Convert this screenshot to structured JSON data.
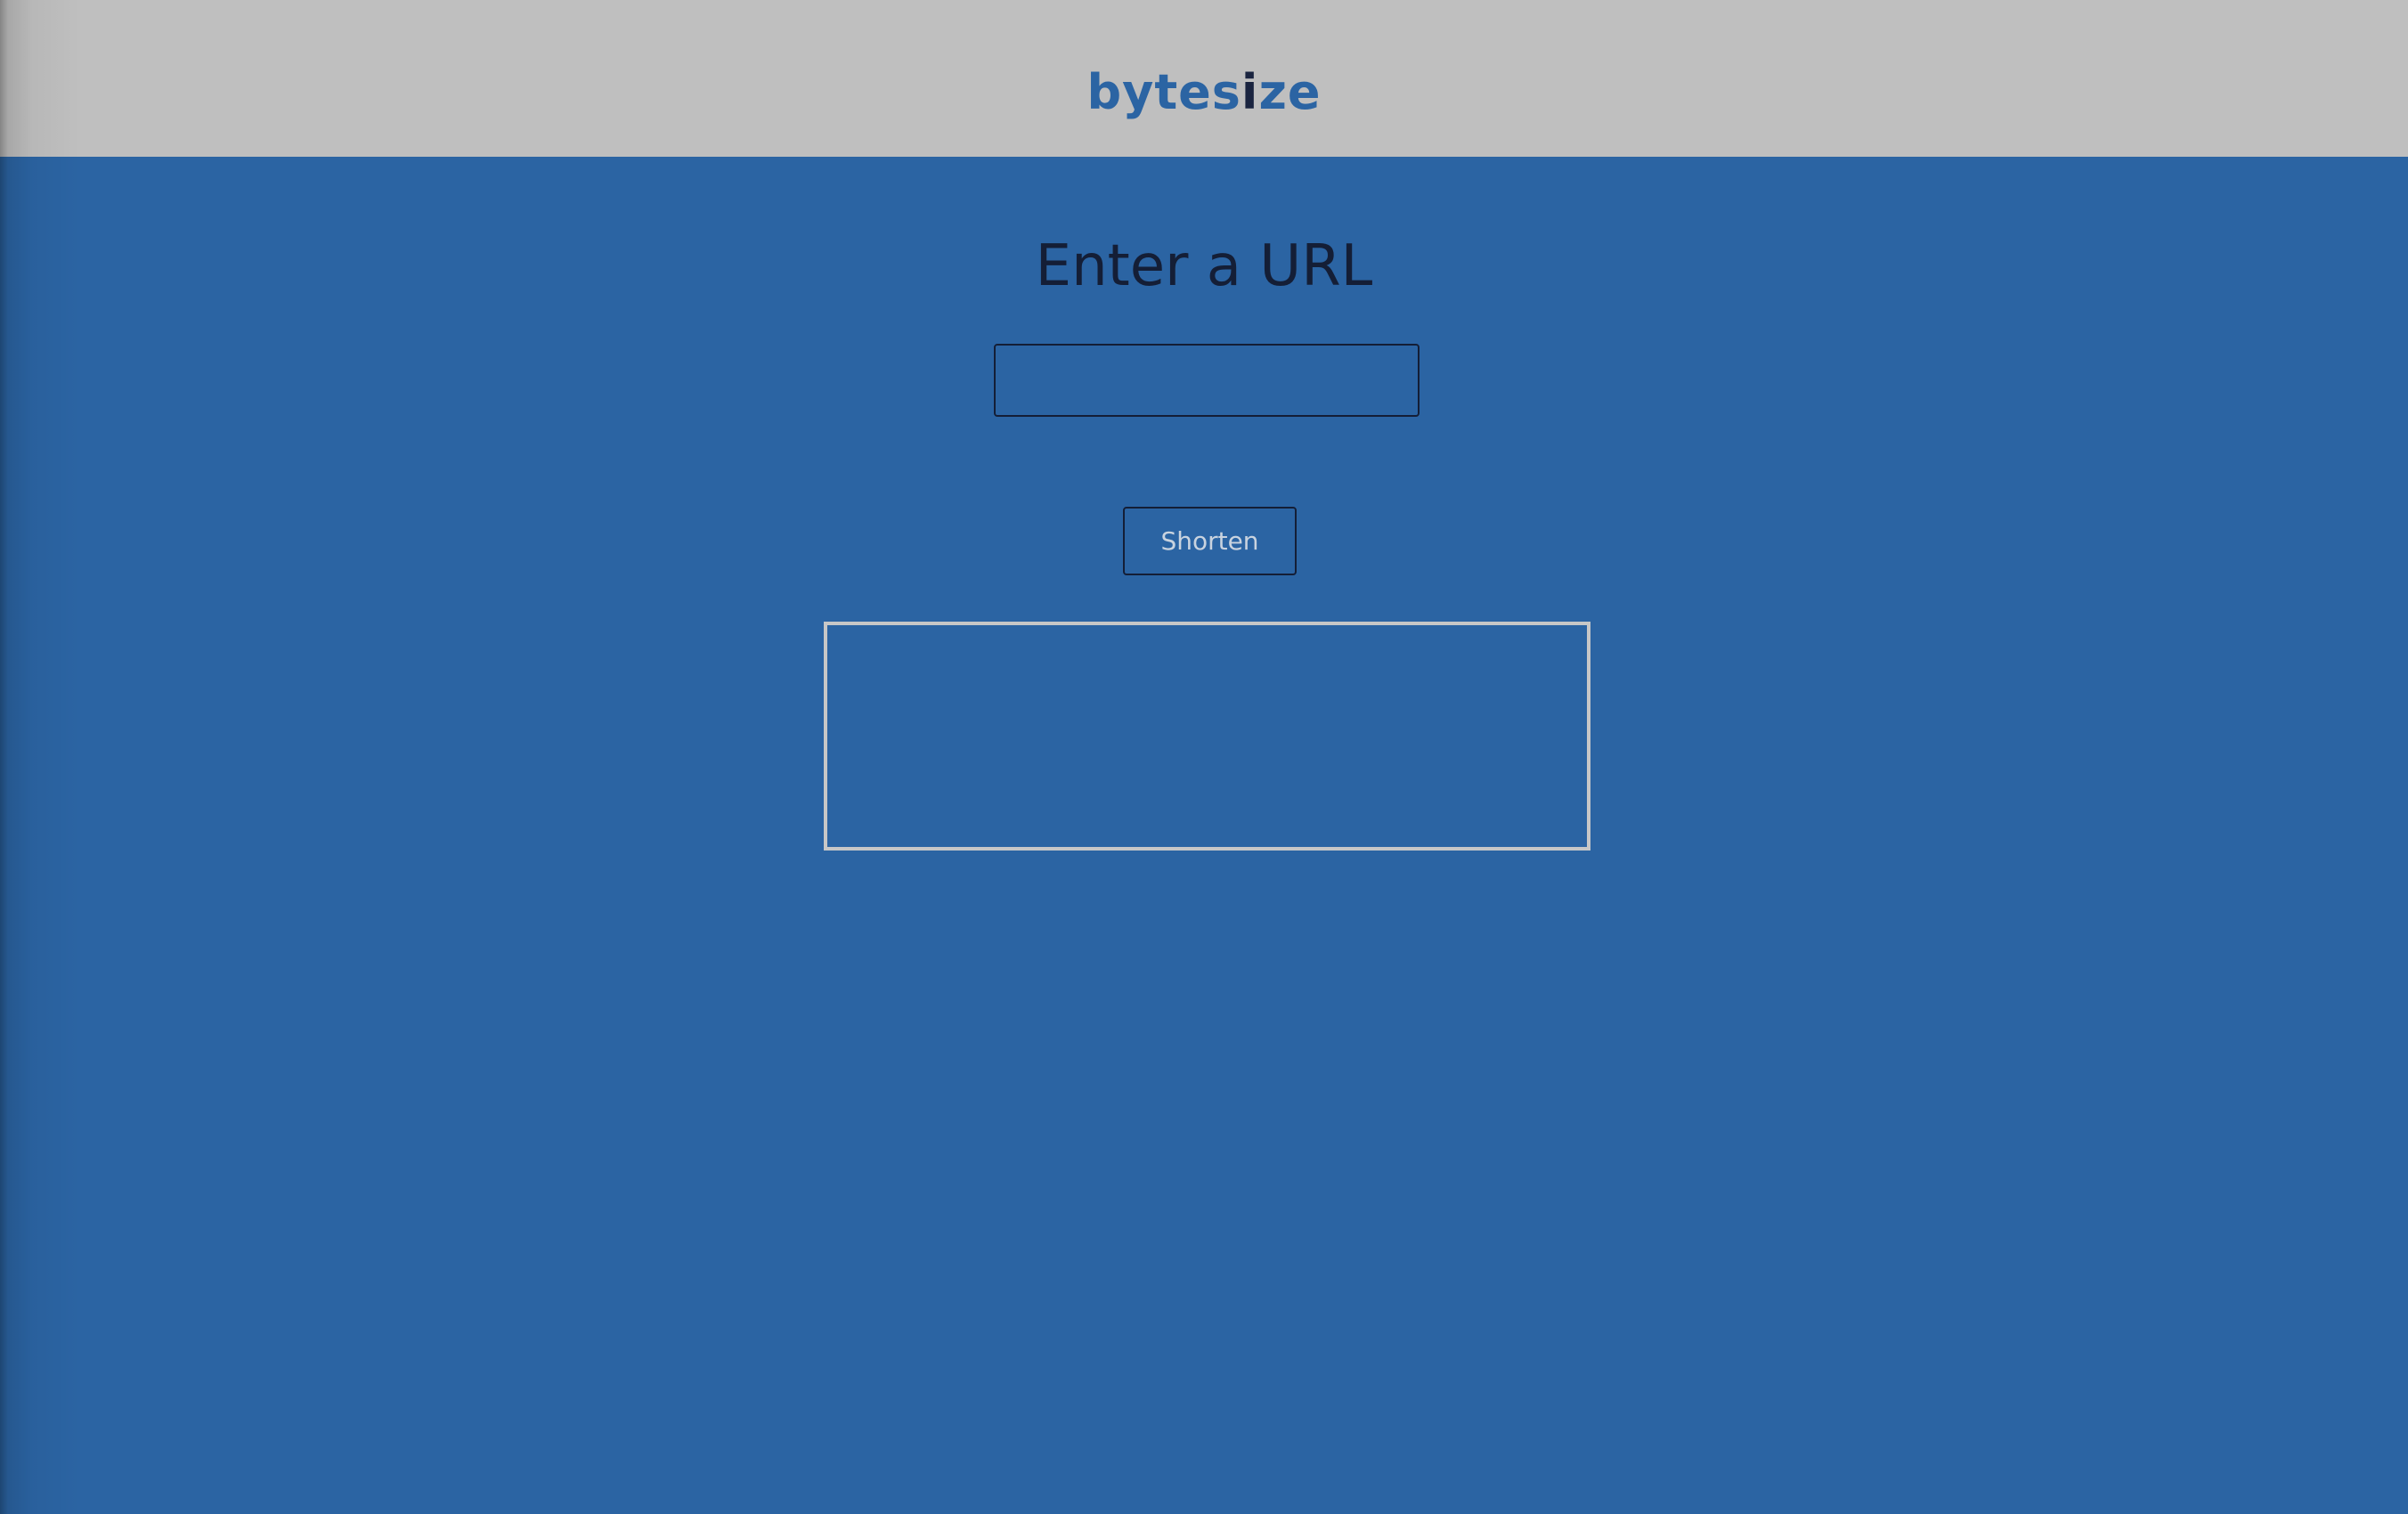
{
  "header": {
    "logo": {
      "part1": "bytes",
      "part2": "i",
      "part3": "ze"
    }
  },
  "main": {
    "heading": "Enter a URL",
    "url_input": {
      "value": "",
      "placeholder": ""
    },
    "shorten_label": "Shorten",
    "result_text": ""
  },
  "colors": {
    "background": "#2b64a3",
    "header": "#bfbfbf",
    "text_dark": "#141e36",
    "result_border": "#c7c7c7"
  }
}
